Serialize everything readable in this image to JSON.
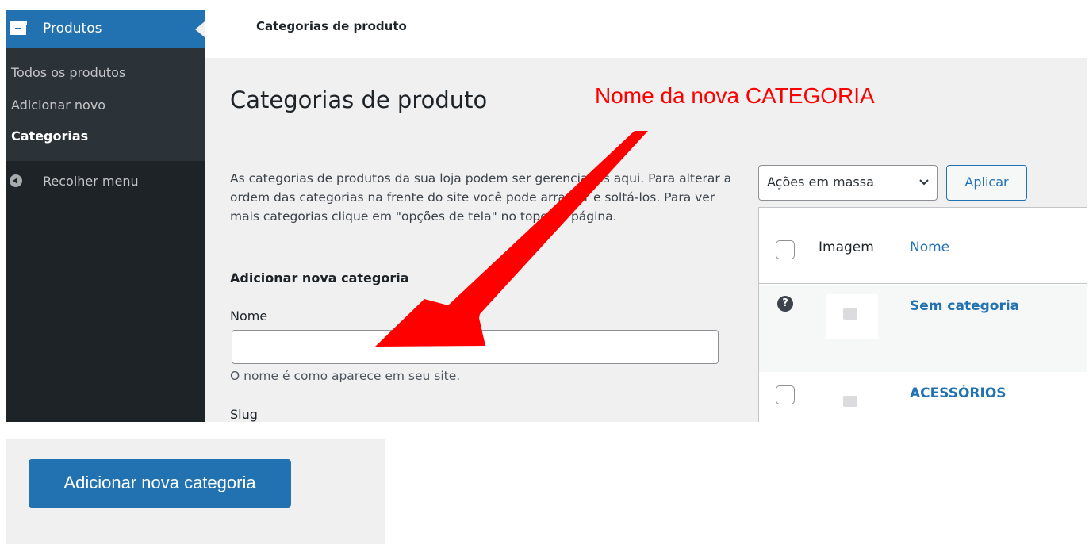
{
  "sidebar": {
    "menu_label": "Produtos",
    "items": [
      {
        "label": "Todos os produtos",
        "active": false
      },
      {
        "label": "Adicionar novo",
        "active": false
      },
      {
        "label": "Categorias",
        "active": true
      }
    ],
    "collapse_label": "Recolher menu"
  },
  "topbar": {
    "title": "Categorias de produto"
  },
  "main": {
    "page_title": "Categorias de produto",
    "annotation": "Nome da nova CATEGORIA",
    "help_text": "As categorias de produtos da sua loja podem ser gerenciadas aqui. Para alterar a ordem das categorias na frente do site você pode arrastar e soltá-los. Para ver mais categorias clique em \"opções de tela\" no topo da página.",
    "form": {
      "heading": "Adicionar nova categoria",
      "name_label": "Nome",
      "name_value": "",
      "name_description": "O nome é como aparece em seu site.",
      "slug_label": "Slug"
    }
  },
  "list": {
    "bulk_action": "Ações em massa",
    "apply_label": "Aplicar",
    "columns": {
      "image": "Imagem",
      "name": "Nome"
    },
    "rows": [
      {
        "name": "Sem categoria"
      },
      {
        "name": "ACESSÓRIOS"
      }
    ]
  },
  "bottom": {
    "add_button_label": "Adicionar nova categoria"
  },
  "colors": {
    "accent": "#2271b1",
    "sidebar": "#1d2327",
    "annotation": "#ff0000"
  }
}
